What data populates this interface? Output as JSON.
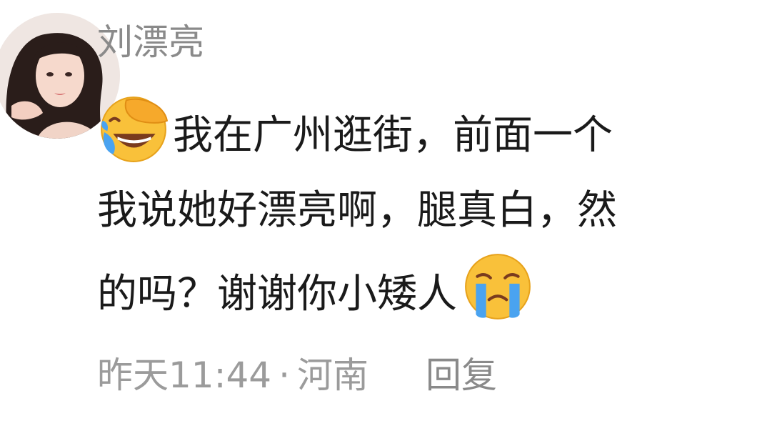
{
  "comment": {
    "username": "刘漂亮",
    "avatar_icon": "avatar-photo-woman",
    "lines": [
      "我在广州逛街，前面一个",
      "我说她好漂亮啊，腿真白，然",
      "的吗？谢谢你小矮人"
    ],
    "emoji_lead": "laughing-crying-face-icon",
    "emoji_trail": "crying-face-icon",
    "time": "昨天11:44",
    "separator": "·",
    "location": "河南",
    "reply_label": "回复"
  }
}
